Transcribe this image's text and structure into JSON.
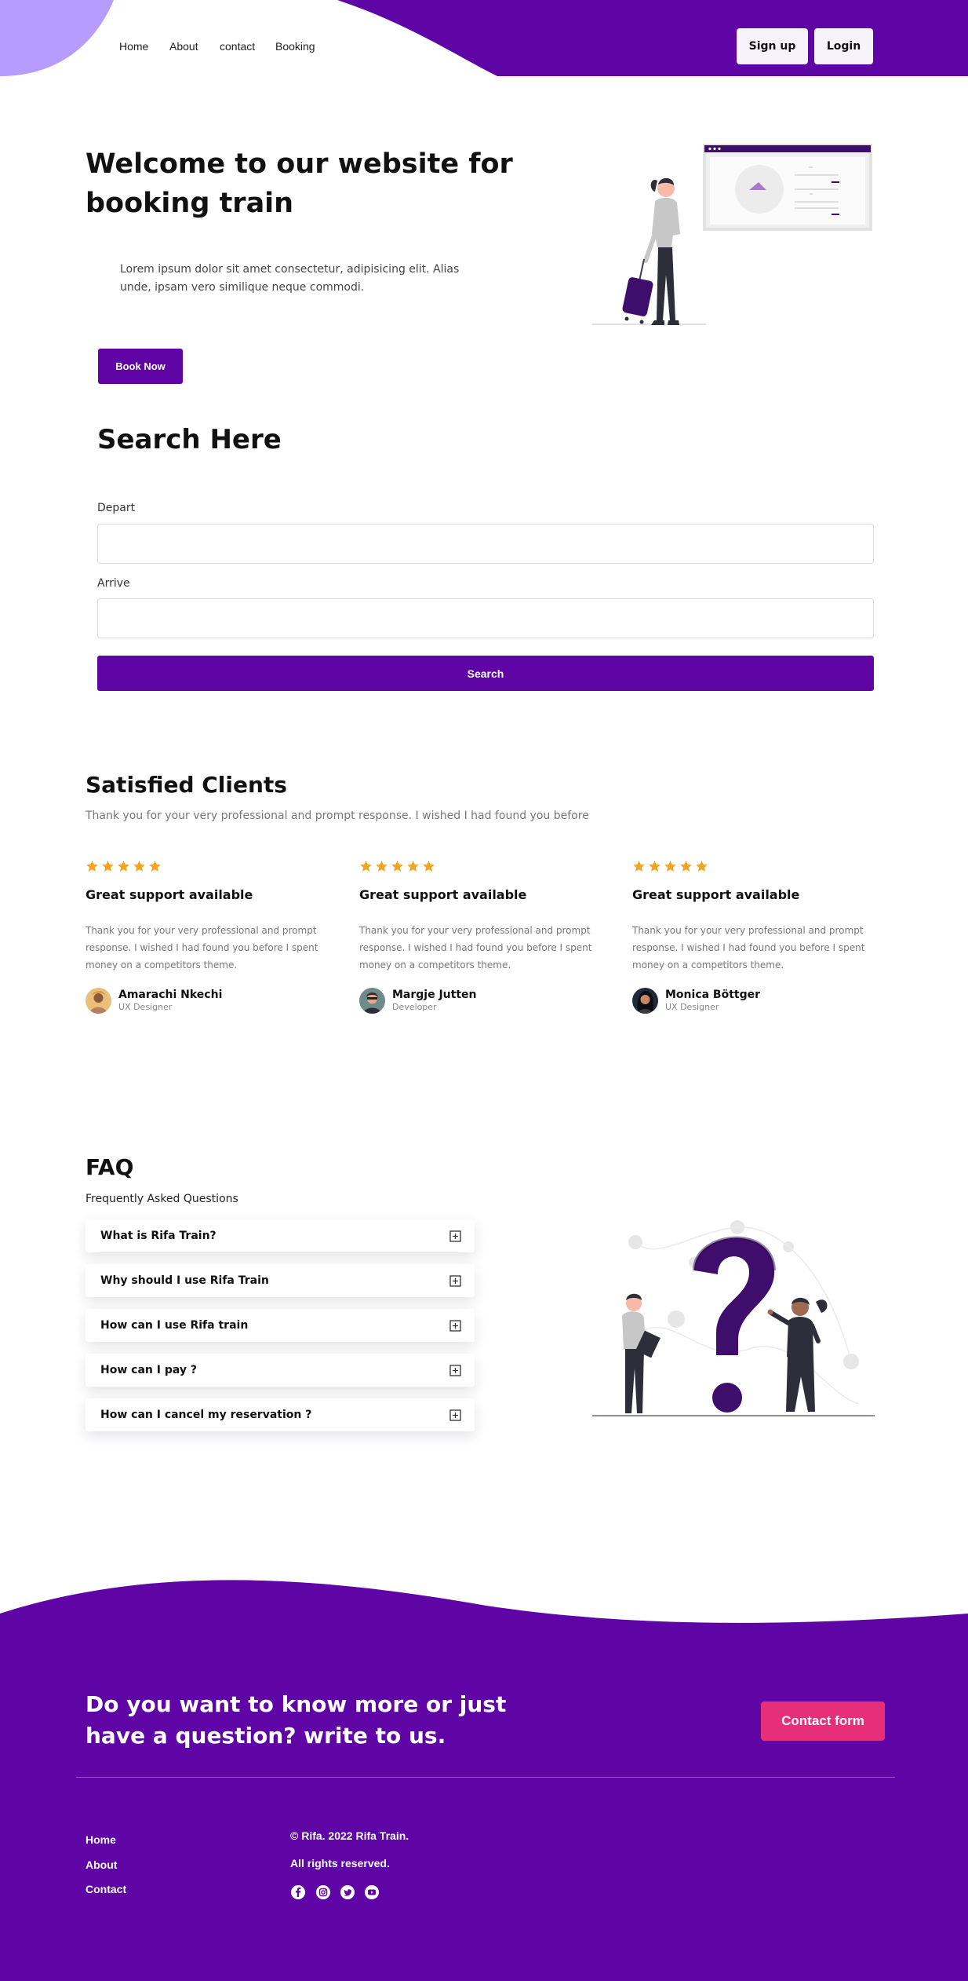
{
  "colors": {
    "brand": "#5f05a6",
    "brand_light": "#b79cff",
    "accent": "#e62e79",
    "star": "#f4a41d"
  },
  "nav": {
    "items": [
      "Home",
      "About",
      "contact",
      "Booking"
    ],
    "signup_label": "Sign up",
    "login_label": "Login"
  },
  "hero": {
    "title": "Welcome to our website for booking train",
    "text": "Lorem ipsum dolor sit amet consectetur, adipisicing elit. Alias unde, ipsam vero similique neque commodi.",
    "cta_label": "Book Now"
  },
  "search": {
    "title": "Search Here",
    "depart_label": "Depart",
    "depart_value": "",
    "arrive_label": "Arrive",
    "arrive_value": "",
    "button_label": "Search"
  },
  "testimonials": {
    "title": "Satisfied Clients",
    "subtitle": "Thank you for your very professional and prompt response. I wished I had found you before",
    "rating": 5,
    "cards": [
      {
        "title": "Great support available",
        "text": "Thank you for your very professional and prompt response. I wished I had found you before I spent money on a competitors theme.",
        "name": "Amarachi Nkechi",
        "role": "UX Designer"
      },
      {
        "title": "Great support available",
        "text": "Thank you for your very professional and prompt response. I wished I had found you before I spent money on a competitors theme.",
        "name": "Margje Jutten",
        "role": "Developer"
      },
      {
        "title": "Great support available",
        "text": "Thank you for your very professional and prompt response. I wished I had found you before I spent money on a competitors theme.",
        "name": "Monica Böttger",
        "role": "UX Designer"
      }
    ]
  },
  "faq": {
    "title": "FAQ",
    "subtitle": "Frequently Asked Questions",
    "items": [
      "What is Rifa Train?",
      "Why should I use Rifa Train",
      "How can I use Rifa train",
      "How can I pay ?",
      "How can I cancel my reservation ?"
    ],
    "expand_icon": "plus-square-icon"
  },
  "footer": {
    "cta": "Do you want to know more or just have a question? write to us.",
    "contact_label": "Contact form",
    "links": [
      "Home",
      "About",
      "Contact"
    ],
    "copyright": "© Rifa. 2022 Rifa Train.",
    "rights": "All rights reserved.",
    "social_icons": [
      "facebook-icon",
      "instagram-icon",
      "twitter-icon",
      "youtube-icon"
    ]
  }
}
